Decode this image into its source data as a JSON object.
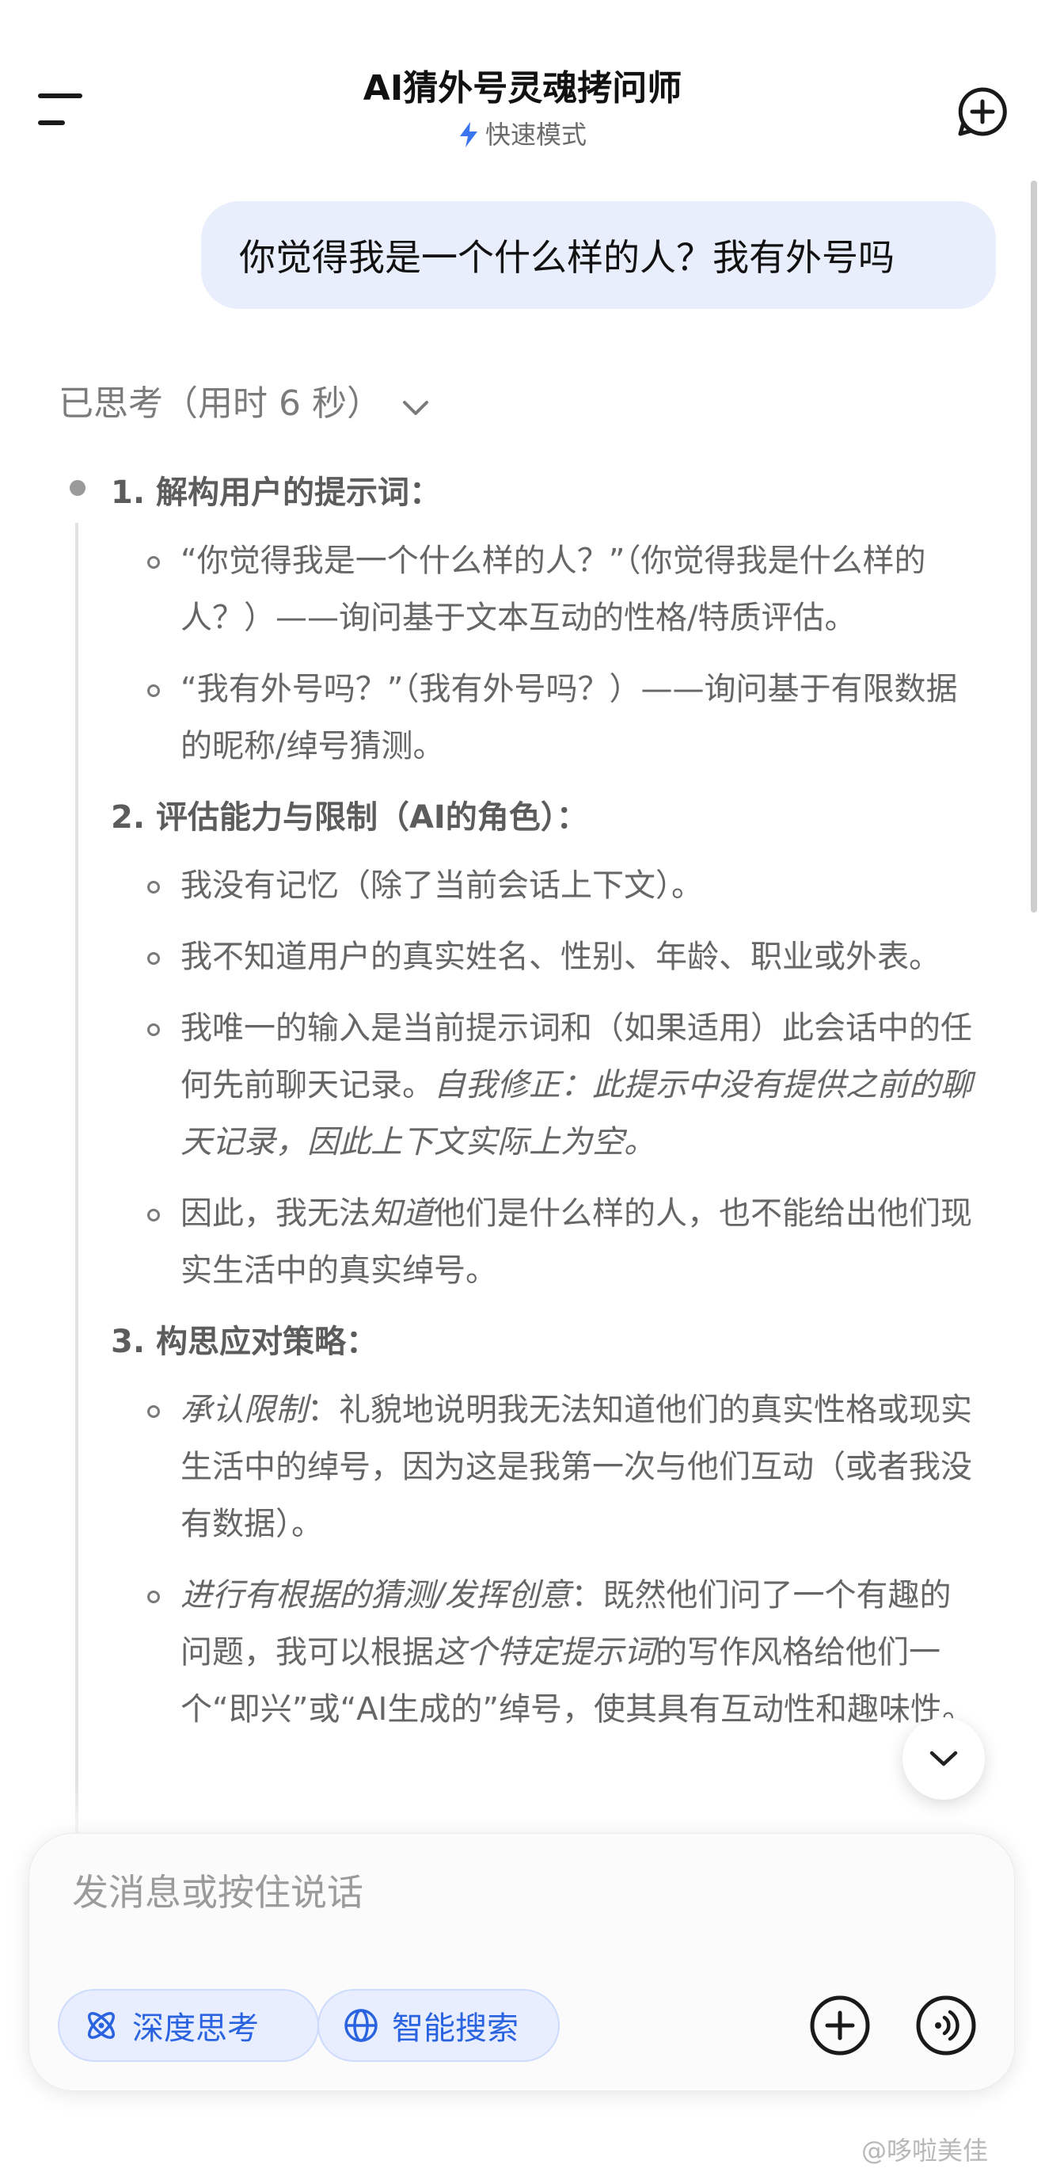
{
  "header": {
    "title": "AI猜外号灵魂拷问师",
    "mode_label": "快速模式",
    "menu_icon": "menu-icon",
    "new_chat_icon": "new-chat-icon"
  },
  "conversation": {
    "user_message": "你觉得我是一个什么样的人？我有外号吗",
    "thinking_toggle": "已思考（用时 6 秒）",
    "sections": [
      {
        "title": "1. 解构用户的提示词：",
        "items": [
          "“你觉得我是一个什么样的人？”（你觉得我是什么样的人？）——询问基于文本互动的性格/特质评估。",
          "“我有外号吗？”（我有外号吗？）——询问基于有限数据的昵称/绰号猜测。"
        ]
      },
      {
        "title": "2. 评估能力与限制（AI的角色）：",
        "items": [
          "我没有记忆（除了当前会话上下文）。",
          "我不知道用户的真实姓名、性别、年龄、职业或外表。",
          "我唯一的输入是当前提示词和（如果适用）此会话中的任何先前聊天记录。",
          "因此，我无法",
          "他们是什么样的人，也不能给出他们现实生活中的真实绰号。"
        ],
        "item3_italic": "自我修正：此提示中没有提供之前的聊天记录，因此上下文实际上为空。",
        "item4_italic": "知道"
      },
      {
        "title": "3. 构思应对策略：",
        "items": [
          "：礼貌地说明我无法知道他们的真实性格或现实生活中的绰号，因为这是我第一次与他们互动（或者我没有数据）。",
          "：既然他们问了一个有趣的问题，我可以根据",
          "的写作风格给他们一个“即兴”或“AI生成的”绰号，使其具有互动性和趣味性。"
        ],
        "item1_italic": "承认限制",
        "item2_italic": "进行有根据的猜测/发挥创意",
        "item2_italic_b": "这个特定提示词"
      }
    ]
  },
  "composer": {
    "placeholder": "发消息或按住说话",
    "deep_think_label": "深度思考",
    "smart_search_label": "智能搜索"
  },
  "watermark": "@哆啦美佳",
  "colors": {
    "accent": "#2a63e0",
    "user_bubble": "#e9eefc",
    "chip_bg": "#e8eefe"
  }
}
